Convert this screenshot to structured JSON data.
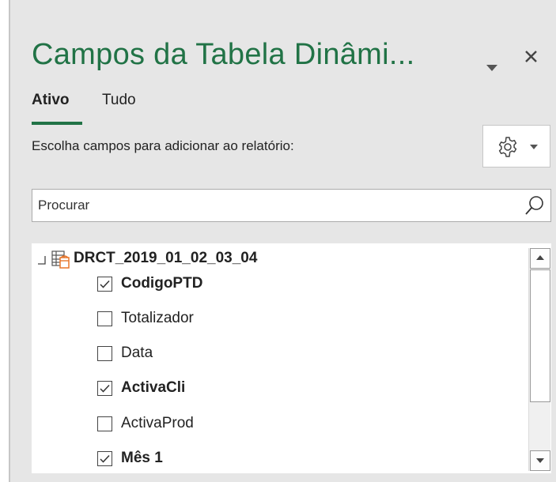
{
  "pane": {
    "title": "Campos da Tabela Dinâmi...",
    "close_glyph": "×",
    "title_dropdown_icon": "chevron-down-icon",
    "close_icon": "close-icon"
  },
  "tabs": [
    {
      "label": "Ativo",
      "active": true
    },
    {
      "label": "Tudo",
      "active": false
    }
  ],
  "instructions": "Escolha campos para adicionar ao relatório:",
  "settings": {
    "icon": "gear-icon",
    "dropdown_icon": "caret-down-icon"
  },
  "search": {
    "placeholder": "Procurar",
    "value": "",
    "icon": "search-icon"
  },
  "field_list": {
    "table_name": "DRCT_2019_01_02_03_04",
    "table_icon": "table-icon",
    "collapse_icon": "collapse-icon",
    "fields": [
      {
        "label": "CodigoPTD",
        "checked": true
      },
      {
        "label": "Totalizador",
        "checked": false
      },
      {
        "label": "Data",
        "checked": false
      },
      {
        "label": "ActivaCli",
        "checked": true
      },
      {
        "label": "ActivaProd",
        "checked": false
      },
      {
        "label": "Mês 1",
        "checked": true
      }
    ]
  },
  "colors": {
    "accent": "#217346",
    "pane_background": "#e6e6e6",
    "table_icon_orange": "#e8762b"
  }
}
